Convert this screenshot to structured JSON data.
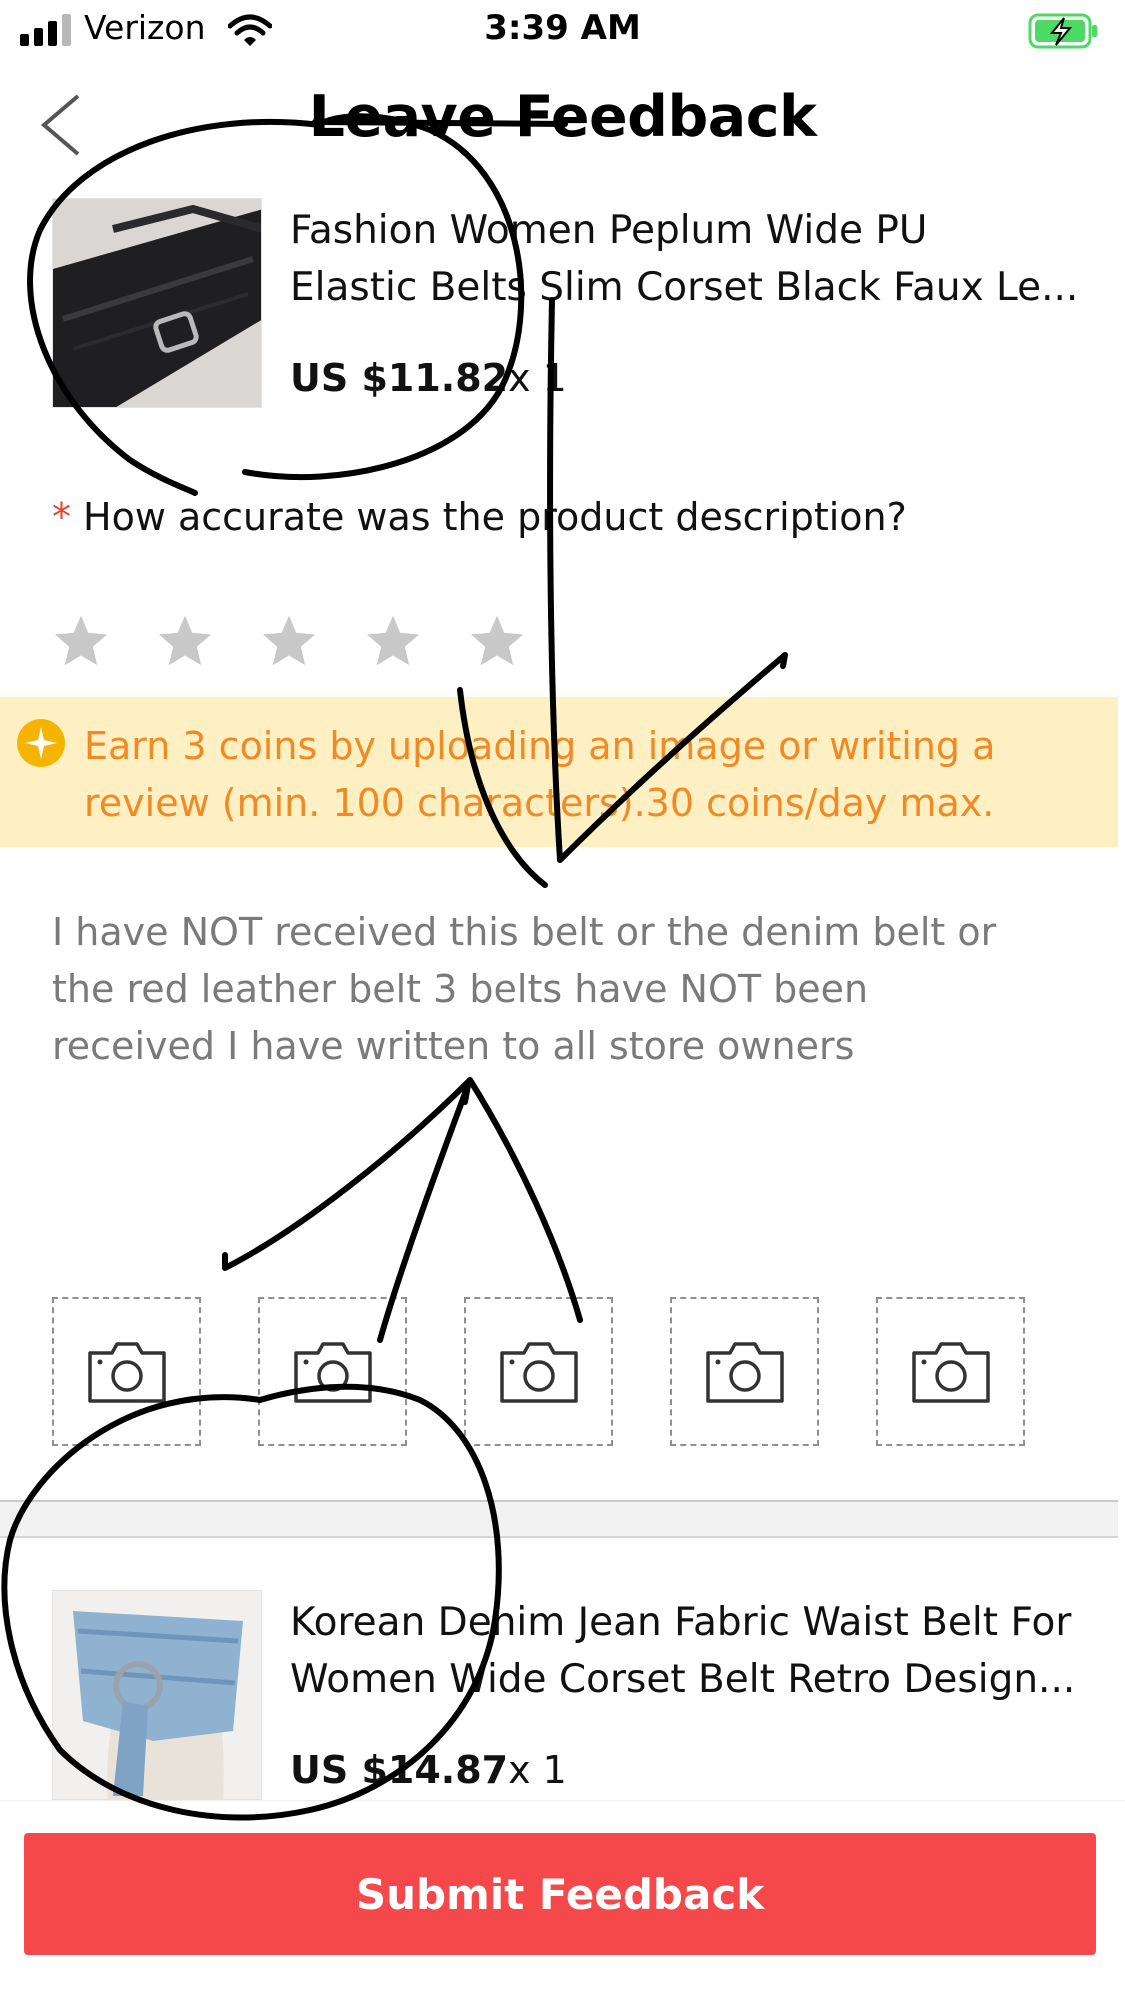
{
  "status_bar": {
    "carrier": "Verizon",
    "time": "3:39 AM"
  },
  "nav": {
    "title": "Leave Feedback",
    "back_icon": "chevron-left-icon"
  },
  "products": [
    {
      "title_line1": "Fashion Women Peplum Wide PU",
      "title_line2": "Elastic Belts Slim Corset Black Faux Le...",
      "price": "US $11.82",
      "qty": "x 1"
    },
    {
      "title_line1": "Korean Denim Jean Fabric Waist Belt For",
      "title_line2": "Women Wide Corset Belt Retro Design...",
      "price": "US $14.87",
      "qty": "x 1"
    }
  ],
  "rating": {
    "required_mark": "*",
    "question": "How accurate was the product description?",
    "stars_total": 5,
    "stars_selected": 0
  },
  "banner": {
    "line1": "Earn 3 coins by uploading an image or writing a",
    "line2": "review (min. 100 characters).30 coins/day max."
  },
  "review": {
    "line1": "I have NOT received this belt or the denim belt or",
    "line2": "the red leather belt 3 belts have NOT been",
    "line3": "received I have written to all store owners"
  },
  "upload_slots": 5,
  "submit_label": "Submit Feedback",
  "colors": {
    "accent_red": "#f5484a",
    "required_red": "#e6452d",
    "banner_bg": "#fef0c2",
    "banner_text": "#f08a24",
    "star_gray": "#c8c8c8",
    "battery_green": "#4cd964"
  }
}
